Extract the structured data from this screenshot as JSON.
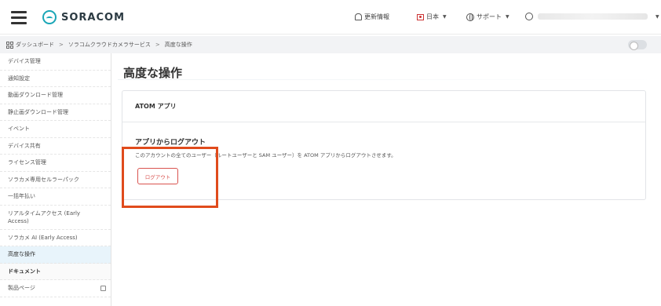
{
  "header": {
    "logo_text": "SORACOM",
    "updates_label": "更新情報",
    "language_label": "日本",
    "support_label": "サポート"
  },
  "breadcrumb": {
    "items": [
      "ダッシュボード",
      "ソラコムクラウドカメラサービス",
      "高度な操作"
    ]
  },
  "sidebar": {
    "items": [
      {
        "label": "デバイス管理"
      },
      {
        "label": "通知設定"
      },
      {
        "label": "動画ダウンロード管理"
      },
      {
        "label": "静止画ダウンロード管理"
      },
      {
        "label": "イベント"
      },
      {
        "label": "デバイス共有"
      },
      {
        "label": "ライセンス管理"
      },
      {
        "label": "ソラカメ専用セルラーパック"
      },
      {
        "label": "一括年払い"
      },
      {
        "label": "リアルタイムアクセス (Early Access)"
      },
      {
        "label": "ソラカメ AI (Early Access)"
      },
      {
        "label": "高度な操作"
      }
    ],
    "section_label": "ドキュメント",
    "doc_items": [
      {
        "label": "製品ページ"
      }
    ]
  },
  "main": {
    "page_title": "高度な操作",
    "card_title": "ATOM アプリ",
    "section_title": "アプリからログアウト",
    "description": "このアカウントの全てのユーザー（ルートユーザーと SAM ユーザー）を ATOM アプリからログアウトさせます。",
    "logout_button": "ログアウト"
  },
  "colors": {
    "accent": "#1aa6b7",
    "danger": "#d9534f",
    "highlight": "#e04b1c",
    "active_bg": "#e8f4fb"
  }
}
